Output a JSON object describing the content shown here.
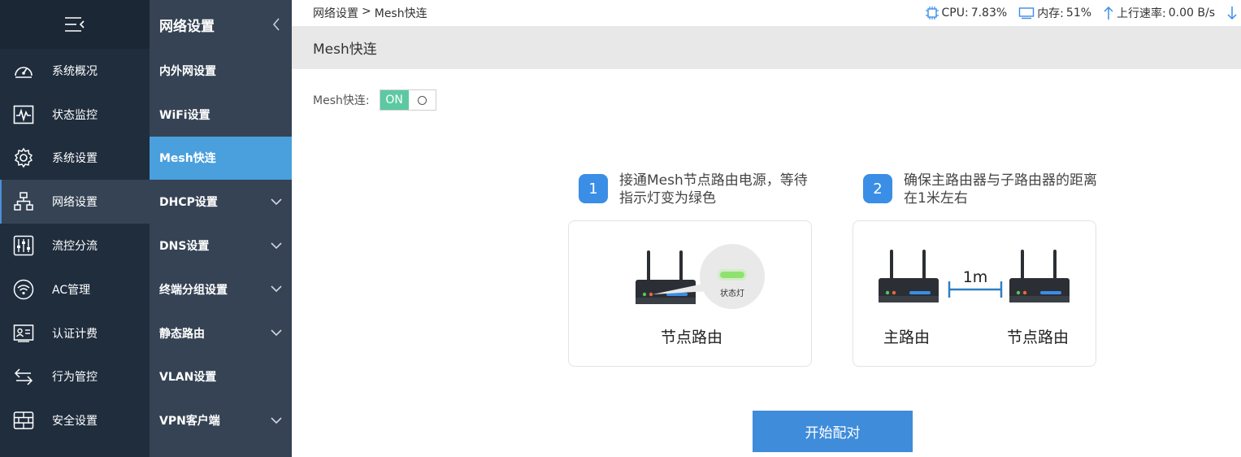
{
  "sidebar": {
    "items": [
      {
        "label": "系统概况",
        "icon": "dashboard-icon"
      },
      {
        "label": "状态监控",
        "icon": "pulse-monitor-icon"
      },
      {
        "label": "系统设置",
        "icon": "gear-icon"
      },
      {
        "label": "网络设置",
        "icon": "network-topology-icon"
      },
      {
        "label": "流控分流",
        "icon": "sliders-icon"
      },
      {
        "label": "AC管理",
        "icon": "wifi-icon"
      },
      {
        "label": "认证计费",
        "icon": "id-card-icon"
      },
      {
        "label": "行为管控",
        "icon": "transfer-arrows-icon"
      },
      {
        "label": "安全设置",
        "icon": "firewall-icon"
      }
    ],
    "active_index": 3
  },
  "subnav": {
    "title": "网络设置",
    "items": [
      {
        "label": "内外网设置",
        "expandable": false
      },
      {
        "label": "WiFi设置",
        "expandable": false
      },
      {
        "label": "Mesh快连",
        "expandable": false
      },
      {
        "label": "DHCP设置",
        "expandable": true
      },
      {
        "label": "DNS设置",
        "expandable": true
      },
      {
        "label": "终端分组设置",
        "expandable": true
      },
      {
        "label": "静态路由",
        "expandable": true
      },
      {
        "label": "VLAN设置",
        "expandable": false
      },
      {
        "label": "VPN客户端",
        "expandable": true
      }
    ],
    "active_index": 2
  },
  "breadcrumb": {
    "parent": "网络设置",
    "sep": ">",
    "current": "Mesh快连"
  },
  "status": {
    "cpu_label": "CPU:",
    "cpu_value": "7.83%",
    "mem_label": "内存:",
    "mem_value": "51%",
    "up_label": "上行速率:",
    "up_value": "0.00 B/s"
  },
  "page_title": "Mesh快连",
  "toggle": {
    "label": "Mesh快连:",
    "on_text": "ON",
    "state": true
  },
  "steps": [
    {
      "num": "1",
      "text": "接通Mesh节点路由电源，等待指示灯变为绿色"
    },
    {
      "num": "2",
      "text": "确保主路由器与子路由器的距离在1米左右"
    }
  ],
  "card1": {
    "status_light_label": "状态灯",
    "router_label": "节点路由"
  },
  "card2": {
    "distance": "1m",
    "main_label": "主路由",
    "node_label": "节点路由"
  },
  "start_button": "开始配对",
  "colors": {
    "sidebar_bg": "#1f2d3d",
    "subnav_bg": "#354354",
    "accent": "#4a9fdd",
    "toggle_on": "#5cc9a3",
    "button": "#3f8cdb"
  }
}
